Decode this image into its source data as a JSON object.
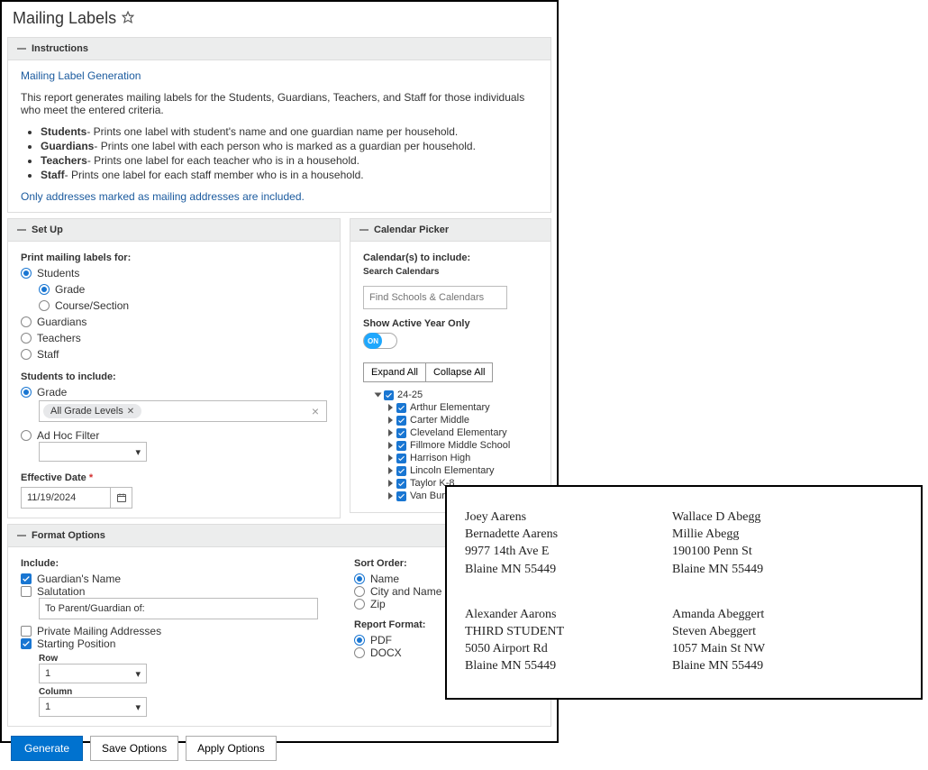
{
  "header": {
    "title": "Mailing Labels"
  },
  "sections": {
    "instructions": {
      "bar": "Instructions",
      "title": "Mailing Label Generation",
      "desc": "This report generates mailing labels for the Students, Guardians, Teachers, and Staff for those individuals who meet the entered criteria.",
      "bullets": [
        {
          "b": "Students",
          "t": "- Prints one label with student's name and one guardian name per household."
        },
        {
          "b": "Guardians",
          "t": "- Prints one label with each person who is marked as a guardian per household."
        },
        {
          "b": "Teachers",
          "t": "- Prints one label for each teacher who is in a household."
        },
        {
          "b": "Staff",
          "t": "- Prints one label for each staff member who is in a household."
        }
      ],
      "note": "Only addresses marked as mailing addresses are included."
    },
    "setup": {
      "bar": "Set Up",
      "print_for_label": "Print mailing labels for:",
      "students": "Students",
      "grade": "Grade",
      "course": "Course/Section",
      "guardians": "Guardians",
      "teachers": "Teachers",
      "staff": "Staff",
      "students_include": "Students to include:",
      "grade2": "Grade",
      "all_grades_chip": "All Grade Levels",
      "adhoc": "Ad Hoc Filter",
      "eff_date_label": "Effective Date",
      "eff_date_value": "11/19/2024"
    },
    "calendar": {
      "bar": "Calendar Picker",
      "include_label": "Calendar(s) to include:",
      "search_label": "Search Calendars",
      "search_placeholder": "Find Schools & Calendars",
      "active_only": "Show Active Year Only",
      "toggle_text": "ON",
      "expand": "Expand All",
      "collapse": "Collapse All",
      "year": "24-25",
      "schools": [
        "Arthur Elementary",
        "Carter Middle",
        "Cleveland Elementary",
        "Fillmore Middle School",
        "Harrison High",
        "Lincoln Elementary",
        "Taylor K-8",
        "Van Buren High School"
      ]
    },
    "format": {
      "bar": "Format Options",
      "include": "Include:",
      "guardian_name": "Guardian's Name",
      "salutation": "Salutation",
      "salutation_value": "To Parent/Guardian of:",
      "private_mail": "Private Mailing Addresses",
      "starting_pos": "Starting Position",
      "row_label": "Row",
      "row_value": "1",
      "col_label": "Column",
      "col_value": "1",
      "sort_order": "Sort Order:",
      "so_name": "Name",
      "so_city": "City and Name",
      "so_zip": "Zip",
      "report_format": "Report Format:",
      "rf_pdf": "PDF",
      "rf_docx": "DOCX"
    }
  },
  "footer": {
    "generate": "Generate",
    "save": "Save Options",
    "apply": "Apply Options"
  },
  "preview": {
    "labels": [
      {
        "l1": "Joey  Aarens",
        "l2": "Bernadette Aarens",
        "l3": "9977 14th Ave E",
        "l4": "Blaine MN 55449"
      },
      {
        "l1": "Wallace D Abegg",
        "l2": "Millie Abegg",
        "l3": "190100 Penn St",
        "l4": "Blaine MN 55449"
      },
      {
        "l1": "Alexander  Aarons",
        "l2": "THIRD STUDENT",
        "l3": "5050 Airport Rd",
        "l4": "Blaine MN 55449"
      },
      {
        "l1": "Amanda  Abeggert",
        "l2": "Steven Abeggert",
        "l3": "1057 Main St NW",
        "l4": "Blaine MN 55449"
      }
    ]
  }
}
